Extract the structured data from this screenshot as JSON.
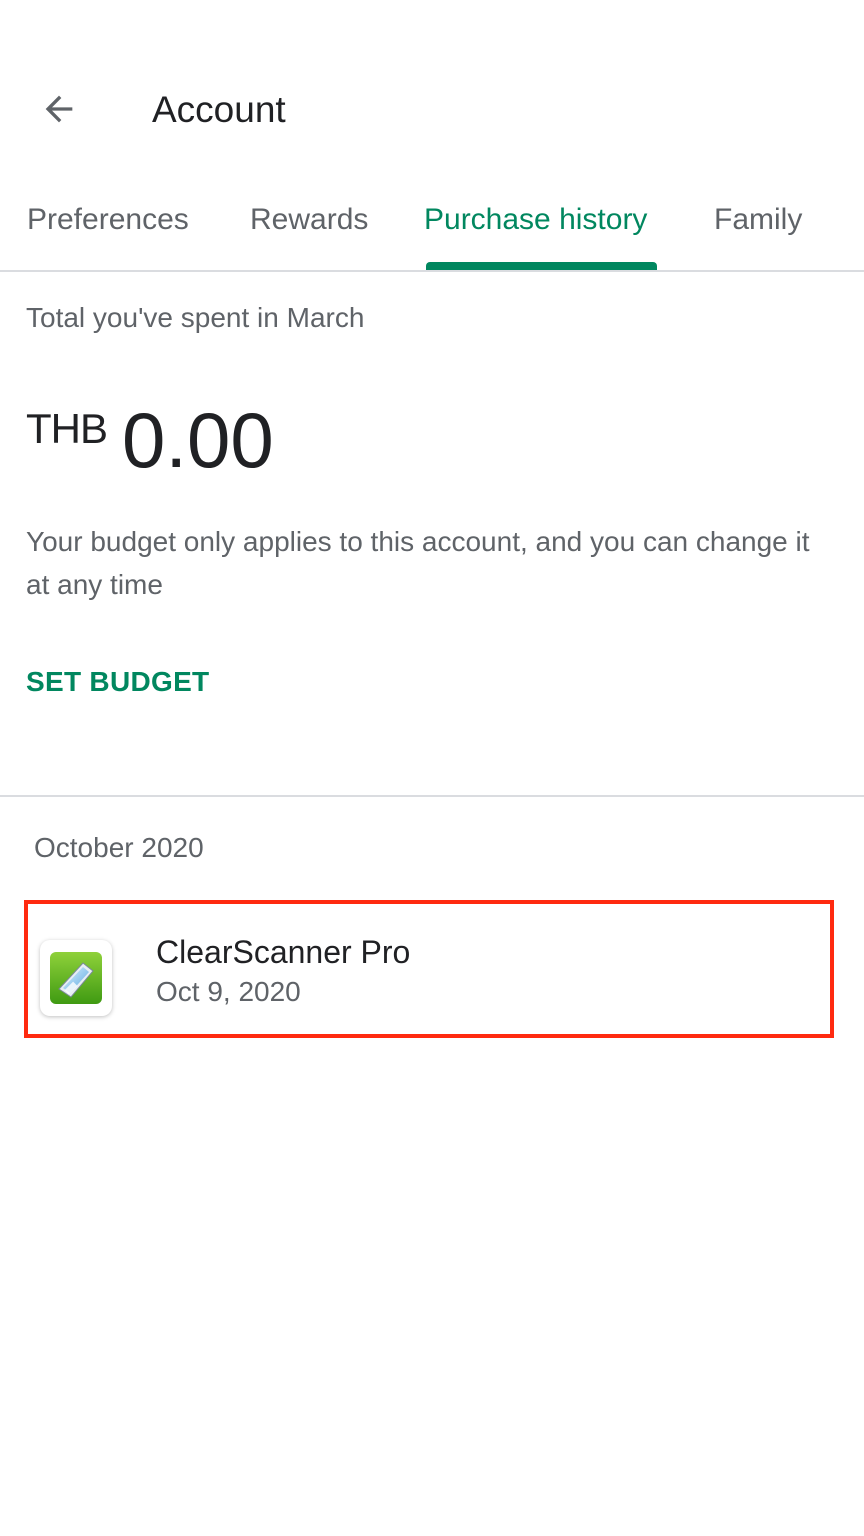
{
  "appbar": {
    "back_icon": "arrow-back-icon",
    "title": "Account"
  },
  "tabs": [
    {
      "label": "Preferences",
      "active": false
    },
    {
      "label": "Rewards",
      "active": false
    },
    {
      "label": "Purchase history",
      "active": true
    },
    {
      "label": "Family",
      "active": false
    }
  ],
  "summary": {
    "spent_label": "Total you've spent in March",
    "currency": "THB",
    "amount": "0.00",
    "budget_description": "Your budget only applies to this account, and you can change it at any time",
    "set_budget_label": "SET BUDGET"
  },
  "history": {
    "month": "October 2020",
    "items": [
      {
        "name": "ClearScanner Pro",
        "date": "Oct 9, 2020",
        "icon": "clearscanner-app-icon",
        "highlighted": true
      }
    ]
  },
  "colors": {
    "accent": "#01875f",
    "highlight_border": "#ff2a10",
    "text_primary": "#202124",
    "text_secondary": "#5f6368",
    "divider": "#dadce0"
  }
}
